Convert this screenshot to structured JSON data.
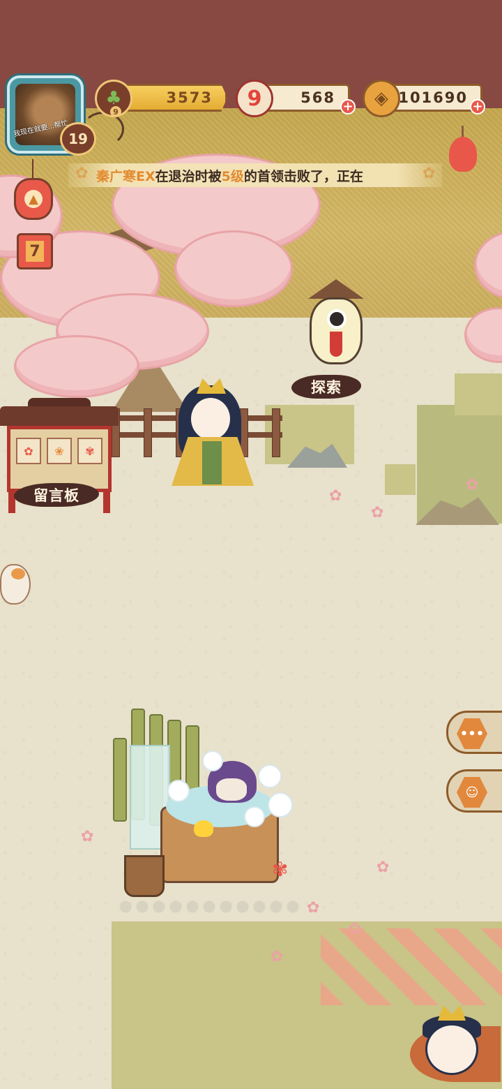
{
  "player": {
    "avatar_caption": "我现在就要...帮忙",
    "level": "19"
  },
  "resources": {
    "pine": {
      "value": "3573",
      "sub_level": "9"
    },
    "food": {
      "value": "568",
      "icon_digit": "9"
    },
    "coin": {
      "value": "101690"
    }
  },
  "ticker": {
    "name": "秦广寒EX",
    "text_1": "在退治时被",
    "level_text": "5级",
    "text_2": "的首领击败了，正在"
  },
  "calendar": {
    "day": "7"
  },
  "labels": {
    "explore": "探索",
    "message_board": "留言板"
  },
  "icons": {
    "pine": "pine-branch-icon",
    "food": "onigiri-icon",
    "coin": "copper-coin-icon",
    "add": "plus-icon",
    "fish_banner": "koinobori-fish-icon",
    "upgrade": "lantern-upgrade-icon",
    "chat": "chat-bubble-icon",
    "shop": "shop-character-icon"
  },
  "colors": {
    "top_band": "#874941",
    "gold_wall": "#d4b867",
    "sand": "#e8e1cc",
    "highlight": "#e28a2e",
    "blossom": "#f4c9c9"
  }
}
